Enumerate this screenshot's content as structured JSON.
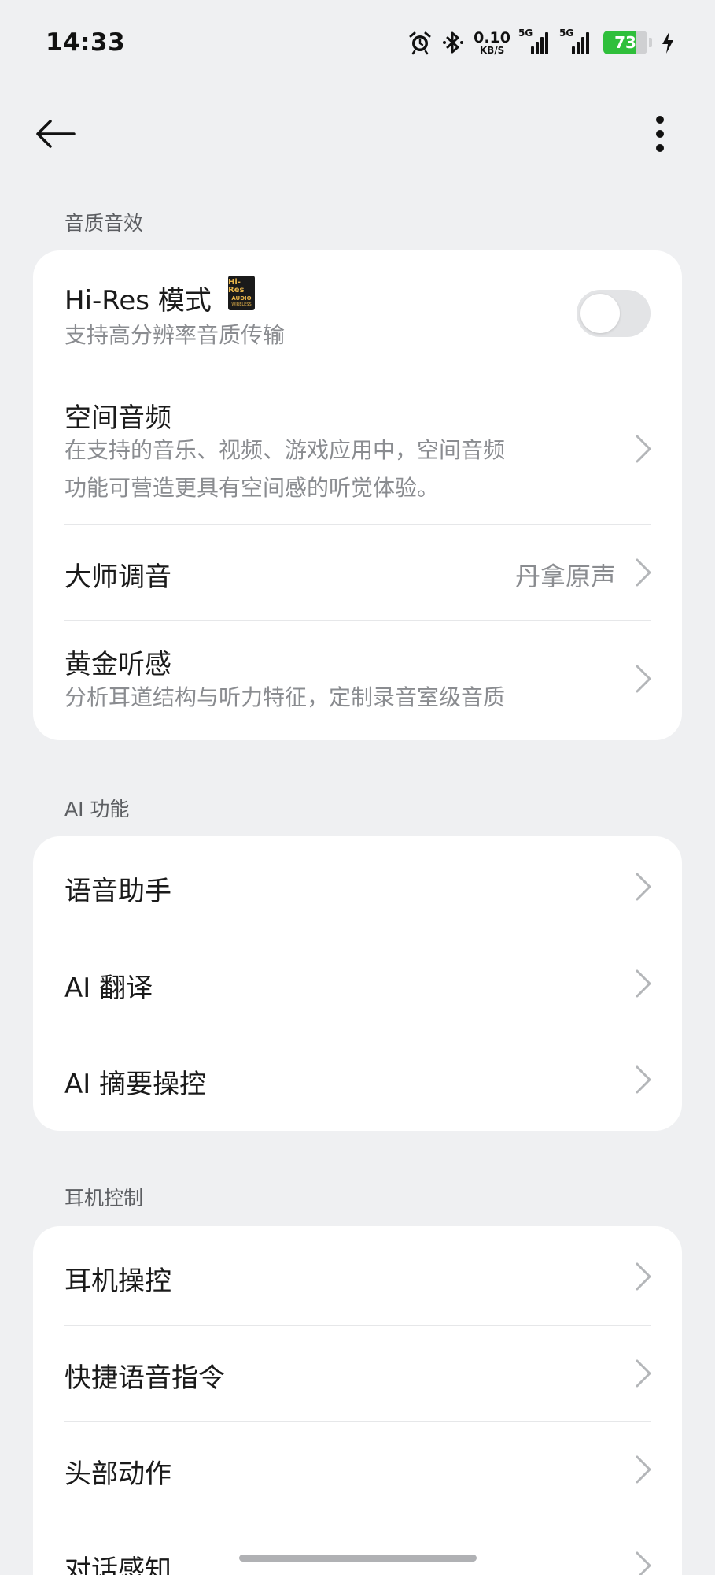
{
  "status_bar": {
    "time": "14:33",
    "net_speed_value": "0.10",
    "net_speed_unit": "KB/S",
    "sim1_tag": "5G",
    "sim2_tag": "5G",
    "battery_level": "73",
    "icons": [
      "alarm-icon",
      "bluetooth-icon",
      "signal-icon",
      "signal-icon",
      "battery-icon",
      "charging-icon"
    ]
  },
  "app_bar": {
    "back_icon": "arrow-left-icon",
    "menu_icon": "more-vertical-icon"
  },
  "sections": {
    "audio": {
      "title": "音质音效",
      "hires": {
        "title": "Hi-Res 模式",
        "subtitle": "支持高分辨率音质传输",
        "badge_l1": "Hi-Res",
        "badge_l2": "AUDIO",
        "badge_l3": "WIRELESS",
        "toggle_on": false
      },
      "spatial": {
        "title": "空间音频",
        "subtitle_line1": "在支持的音乐、视频、游戏应用中，空间音频",
        "subtitle_line2": "功能可营造更具有空间感的听觉体验。"
      },
      "master": {
        "title": "大师调音",
        "value": "丹拿原声"
      },
      "golden": {
        "title": "黄金听感",
        "subtitle": "分析耳道结构与听力特征，定制录音室级音质"
      }
    },
    "ai": {
      "title": "AI 功能",
      "items": [
        "语音助手",
        "AI 翻译",
        "AI 摘要操控"
      ]
    },
    "earphone": {
      "title": "耳机控制",
      "items": [
        "耳机操控",
        "快捷语音指令",
        "头部动作",
        "对话感知"
      ]
    }
  },
  "colors": {
    "background": "#eff0f2",
    "card": "#ffffff",
    "secondary_text": "#8a8c90",
    "battery": "#2fbf3b"
  }
}
